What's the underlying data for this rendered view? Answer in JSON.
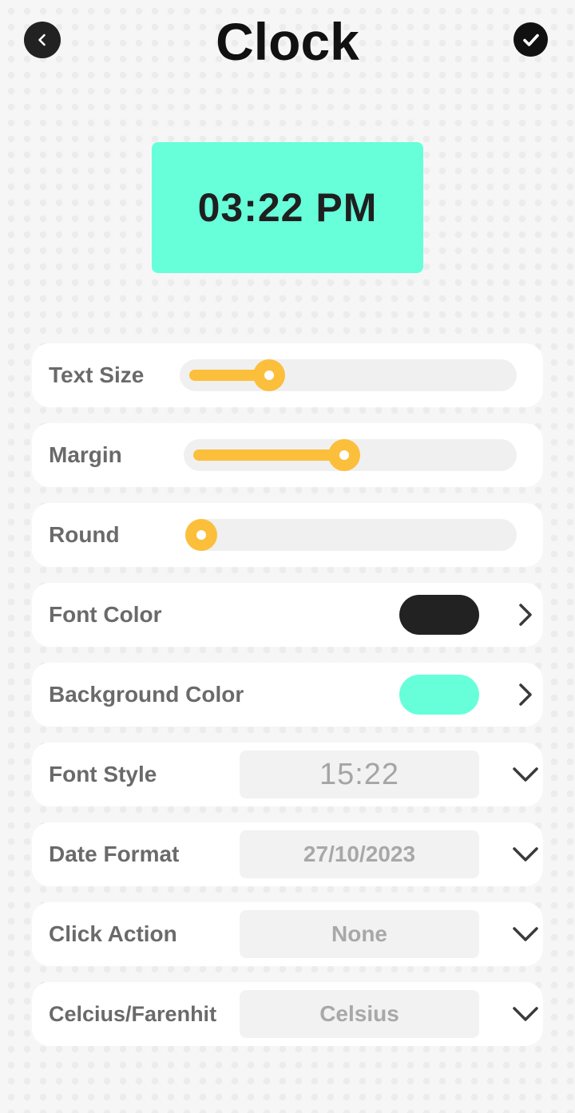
{
  "header": {
    "title": "Clock"
  },
  "preview": {
    "time": "03:22 PM",
    "background": "#66FFDA",
    "text_color": "#1F1F1F"
  },
  "accent": "#FBBF3C",
  "sliders": [
    {
      "label": "Text Size",
      "value": 0.24
    },
    {
      "label": "Margin",
      "value": 0.48
    },
    {
      "label": "Round",
      "value": 0.0
    }
  ],
  "colors": [
    {
      "label": "Font Color",
      "value": "#222222"
    },
    {
      "label": "Background Color",
      "value": "#66FFDA"
    }
  ],
  "selects": [
    {
      "label": "Font Style",
      "value": "15:22"
    },
    {
      "label": "Date Format",
      "value": "27/10/2023"
    },
    {
      "label": "Click Action",
      "value": "None"
    },
    {
      "label": "Celcius/Farenhit",
      "value": "Celsius"
    }
  ],
  "icons": {
    "back": "chevron-left-icon",
    "confirm": "check-icon",
    "color_row": "chevron-right-icon",
    "select_row": "chevron-down-icon"
  }
}
